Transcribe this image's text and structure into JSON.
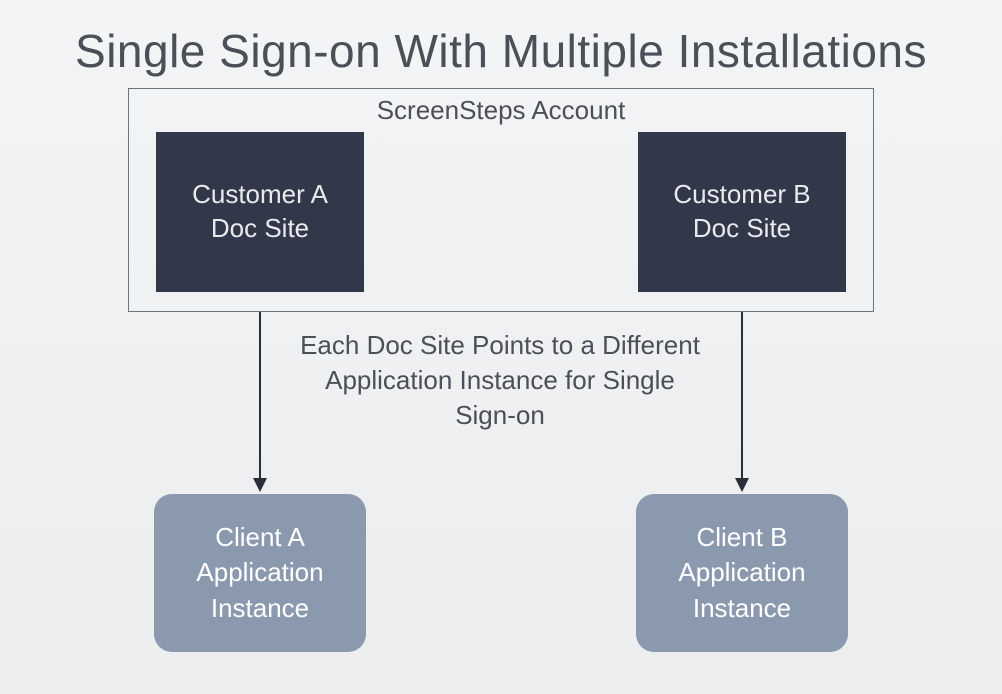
{
  "title": "Single Sign-on With Multiple Installations",
  "account": {
    "label": "ScreenSteps Account",
    "docSiteA": "Customer A\nDoc Site",
    "docSiteB": "Customer B\nDoc Site"
  },
  "middleText": "Each Doc Site Points to a Different Application Instance for Single Sign-on",
  "appInstanceA": "Client A\nApplication\nInstance",
  "appInstanceB": "Client B\nApplication\nInstance"
}
